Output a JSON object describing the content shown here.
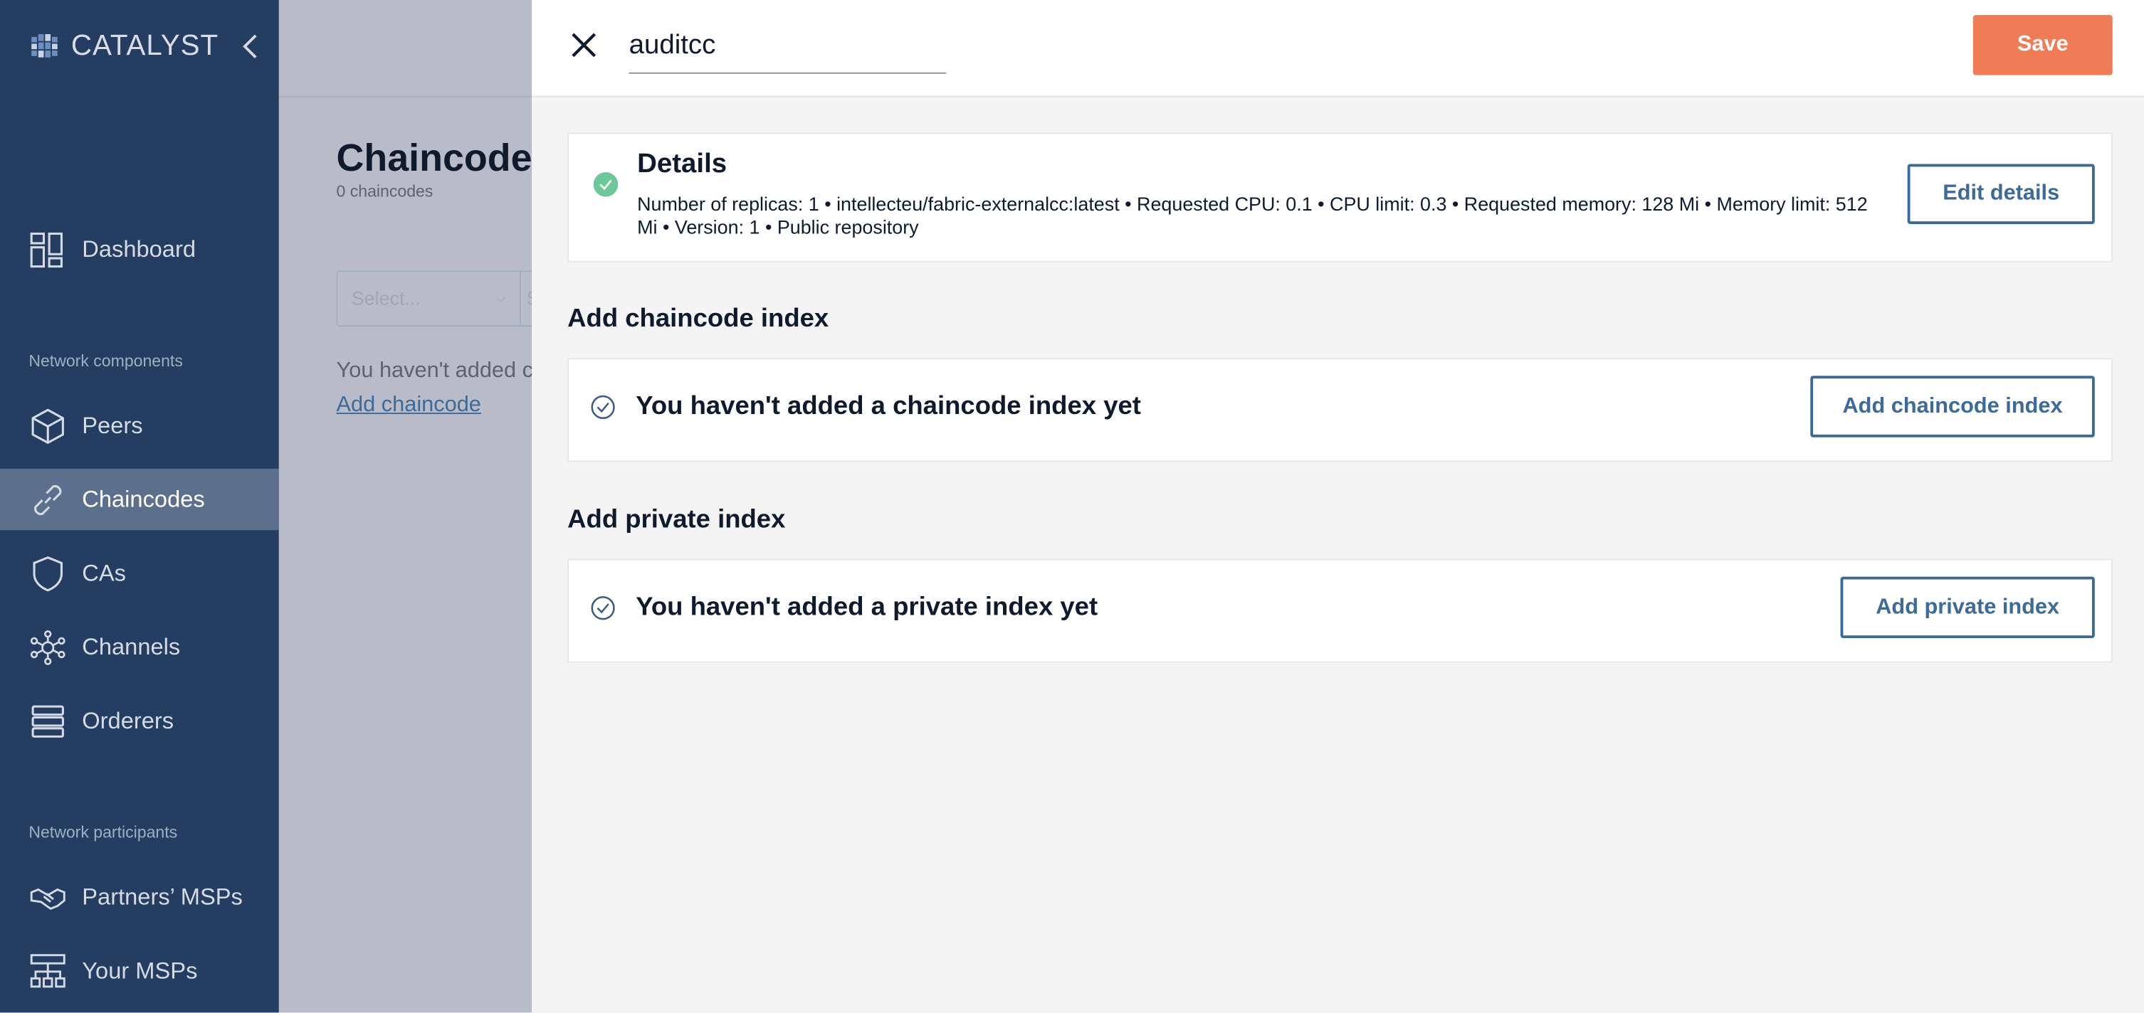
{
  "sidebar": {
    "logo": "CATALYST",
    "items": [
      {
        "label": "Dashboard",
        "icon": "dashboard-icon"
      }
    ],
    "section_components": "Network components",
    "components": [
      {
        "label": "Peers",
        "icon": "cube-icon"
      },
      {
        "label": "Chaincodes",
        "icon": "link-icon",
        "active": true
      },
      {
        "label": "CAs",
        "icon": "shield-icon"
      },
      {
        "label": "Channels",
        "icon": "network-icon"
      },
      {
        "label": "Orderers",
        "icon": "server-icon"
      }
    ],
    "section_participants": "Network participants",
    "participants": [
      {
        "label": "Partners’ MSPs",
        "icon": "handshake-icon"
      },
      {
        "label": "Your MSPs",
        "icon": "hierarchy-icon"
      }
    ]
  },
  "main": {
    "title": "Chaincodes",
    "subtitle": "0 chaincodes",
    "select_placeholder": "Select...",
    "second_field": "S",
    "empty_text": "You haven't added c",
    "add_link": "Add chaincode"
  },
  "panel": {
    "name_value": "auditcc",
    "save": "Save",
    "details": {
      "title": "Details",
      "text": "Number of replicas: 1 • intellecteu/fabric-externalcc:latest • Requested CPU: 0.1 • CPU limit: 0.3 • Requested memory: 128 Mi • Memory limit: 512 Mi • Version: 1 • Public repository",
      "button": "Edit details",
      "status_color": "#6cc898"
    },
    "chaincode_index": {
      "heading": "Add chaincode index",
      "empty": "You haven't added a chaincode index yet",
      "button": "Add chaincode index"
    },
    "private_index": {
      "heading": "Add private index",
      "empty": "You haven't added a private index yet",
      "button": "Add private index"
    }
  },
  "colors": {
    "sidebar": "#243d60",
    "accent": "#f07c56",
    "button_border": "#3b6a9a"
  }
}
